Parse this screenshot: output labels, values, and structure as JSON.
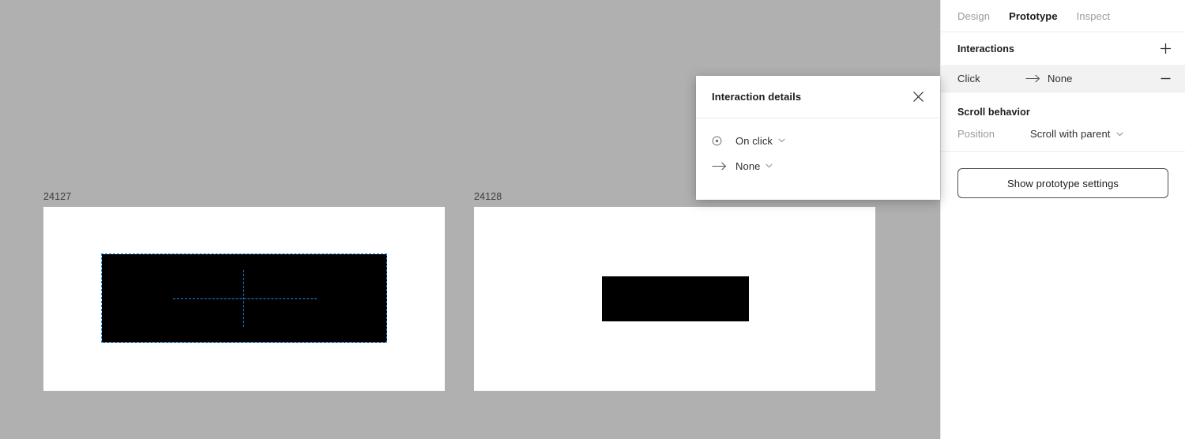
{
  "canvas": {
    "background_color": "#b0b0b0",
    "selection_color": "#1a8cf0",
    "frames": [
      {
        "label": "24127",
        "fill": "#ffffff",
        "rect_fill": "#000000",
        "selected": true
      },
      {
        "label": "24128",
        "fill": "#ffffff",
        "rect_fill": "#000000",
        "selected": false
      }
    ]
  },
  "popup": {
    "title": "Interaction details",
    "close_icon": "close-icon",
    "trigger": {
      "icon": "click-target-icon",
      "value": "On click",
      "caret": "chevron-down-icon"
    },
    "action": {
      "icon": "arrow-right-icon",
      "value": "None",
      "caret": "chevron-down-icon"
    }
  },
  "panel": {
    "tabs": [
      {
        "label": "Design",
        "active": false
      },
      {
        "label": "Prototype",
        "active": true
      },
      {
        "label": "Inspect",
        "active": false
      }
    ],
    "interactions": {
      "title": "Interactions",
      "add_icon": "plus-icon",
      "rows": [
        {
          "trigger": "Click",
          "arrow_icon": "arrow-right-icon",
          "destination": "None",
          "remove_icon": "minus-icon"
        }
      ]
    },
    "scroll_behavior": {
      "title": "Scroll behavior",
      "position_label": "Position",
      "position_value": "Scroll with parent",
      "caret": "chevron-down-icon"
    },
    "prototype_settings_button": "Show prototype settings"
  }
}
